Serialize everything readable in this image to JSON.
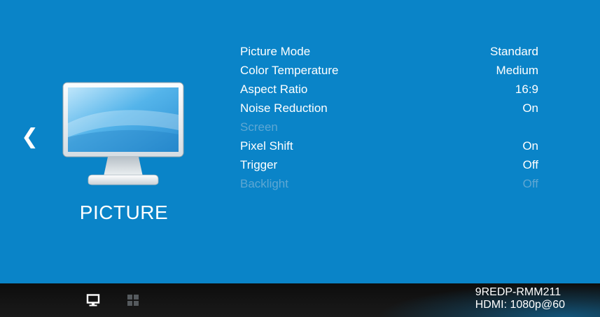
{
  "nav": {
    "back_icon": "chevron-left-icon",
    "back_glyph": "❮"
  },
  "section": {
    "icon": "monitor-icon",
    "title": "PICTURE"
  },
  "menu": {
    "items": [
      {
        "label": "Picture Mode",
        "value": "Standard",
        "enabled": true
      },
      {
        "label": "Color Temperature",
        "value": "Medium",
        "enabled": true
      },
      {
        "label": "Aspect Ratio",
        "value": "16:9",
        "enabled": true
      },
      {
        "label": "Noise Reduction",
        "value": "On",
        "enabled": true
      },
      {
        "label": "Screen",
        "value": "",
        "enabled": false
      },
      {
        "label": "Pixel Shift",
        "value": "On",
        "enabled": true
      },
      {
        "label": "Trigger",
        "value": "Off",
        "enabled": true
      },
      {
        "label": "Backlight",
        "value": "Off",
        "enabled": false
      }
    ]
  },
  "footer": {
    "tabs": [
      {
        "name": "picture",
        "icon": "monitor-icon",
        "active": true
      },
      {
        "name": "grid",
        "icon": "grid-icon",
        "active": false
      }
    ],
    "model": "9REDP-RMM211",
    "input_status": "HDMI: 1080p@60"
  },
  "colors": {
    "background": "#0a84c8",
    "footer": "#111111",
    "text": "#ffffff",
    "disabled_text": "#5ea7d3"
  }
}
